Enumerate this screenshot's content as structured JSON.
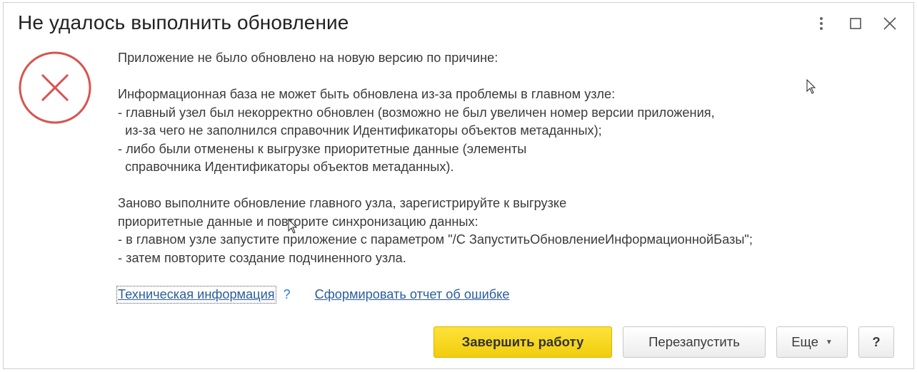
{
  "dialog": {
    "title": "Не удалось выполнить обновление"
  },
  "window_controls": [
    "more-vertical-icon",
    "maximize-icon",
    "close-icon"
  ],
  "message": {
    "lines": [
      "Приложение не было обновлено на новую версию по причине:",
      "",
      "Информационная база не может быть обновлена из-за проблемы в главном узле:",
      "- главный узел был некорректно обновлен (возможно не был увеличен номер версии приложения,",
      "  из-за чего не заполнился справочник Идентификаторы объектов метаданных);",
      "- либо были отменены к выгрузке приоритетные данные (элементы",
      "  справочника Идентификаторы объектов метаданных).",
      "",
      "Заново выполните обновление главного узла, зарегистрируйте к выгрузке",
      "приоритетные данные и повторите синхронизацию данных:",
      "- в главном узле запустите приложение с параметром \"/С ЗапуститьОбновлениеИнформационнойБазы\";",
      "- затем повторите создание подчиненного узла."
    ]
  },
  "links": {
    "tech_info": "Техническая информация",
    "help": "?",
    "report": "Сформировать отчет об ошибке"
  },
  "buttons": {
    "finish": "Завершить работу",
    "restart": "Перезапустить",
    "more": "Еще",
    "help": "?"
  },
  "colors": {
    "error_icon": "#d9534f",
    "primary_button": "#f5d21a",
    "link": "#2a5d9f"
  }
}
